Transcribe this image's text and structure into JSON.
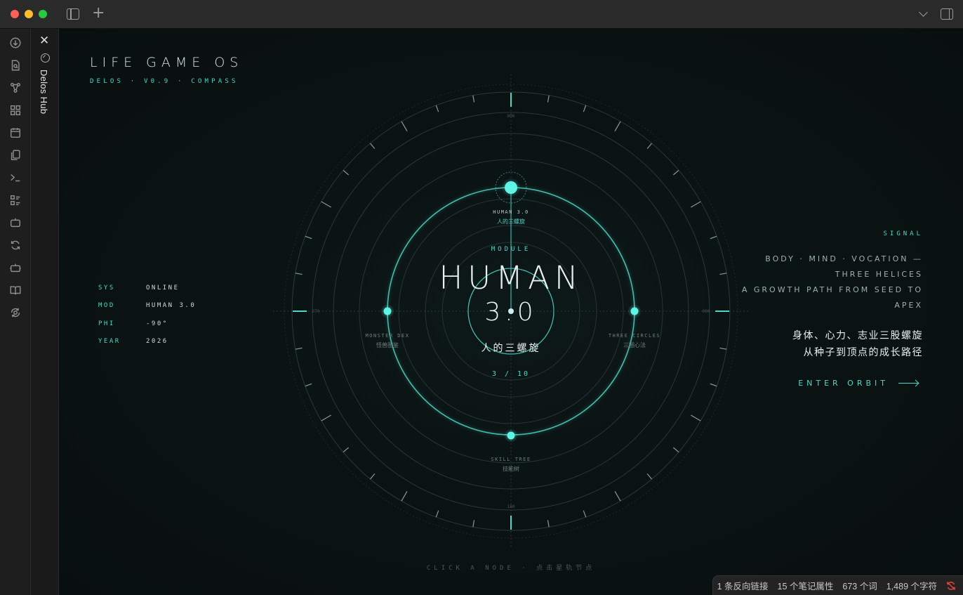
{
  "window": {
    "new_tab_glyph": "+"
  },
  "ribbon": {
    "items": [
      {
        "icon": "download-circle-icon"
      },
      {
        "icon": "file-search-icon"
      },
      {
        "icon": "graph-icon"
      },
      {
        "icon": "dashboard-grid-icon"
      },
      {
        "icon": "calendar-icon"
      },
      {
        "icon": "copy-files-icon"
      },
      {
        "icon": "terminal-icon"
      },
      {
        "icon": "checklist-icon"
      },
      {
        "icon": "bot-icon"
      },
      {
        "icon": "sync-icon"
      },
      {
        "icon": "robot-icon"
      },
      {
        "icon": "book-open-icon"
      },
      {
        "icon": "gear-sync-icon"
      }
    ]
  },
  "side_tab": {
    "label": "Delos Hub"
  },
  "brand": {
    "title": "LIFE GAME OS",
    "subtitle": "DELOS · V0.9 · COMPASS"
  },
  "sys": [
    {
      "key": "SYS",
      "value": "ONLINE"
    },
    {
      "key": "MOD",
      "value": "HUMAN 3.0"
    },
    {
      "key": "PHI",
      "value": "-90°"
    },
    {
      "key": "YEAR",
      "value": "2026"
    }
  ],
  "compass": {
    "module_label": "MODULE",
    "title": "HUMAN",
    "version": "3.0",
    "subtitle_zh": "人的三螺旋",
    "index": "3 / 10",
    "degree_top": "000",
    "degree_right": "090",
    "degree_bottom": "180",
    "degree_left": "270",
    "nodes": {
      "top": {
        "en": "HUMAN 3.0",
        "zh": "人的三螺旋"
      },
      "left": {
        "en": "MONSTER DEX",
        "zh": "怪兽图鉴"
      },
      "right": {
        "en": "THREE CIRCLES",
        "zh": "三圈心法"
      },
      "bottom": {
        "en": "SKILL TREE",
        "zh": "技能树"
      }
    }
  },
  "signal": {
    "label": "SIGNAL",
    "line_en_1": "BODY · MIND · VOCATION — THREE HELICES",
    "line_en_2": "A GROWTH PATH FROM SEED TO APEX",
    "line_zh_1": "身体、心力、志业三股螺旋",
    "line_zh_2": "从种子到顶点的成长路径"
  },
  "cta": {
    "enter_orbit": "ENTER ORBIT"
  },
  "hint": "CLICK A NODE · 点击星轨节点",
  "statusbar": {
    "backlinks": "1 条反向链接",
    "properties": "15 个笔记属性",
    "words": "673 个词",
    "chars": "1,489 个字符"
  },
  "colors": {
    "accent": "#4fd6c9",
    "node": "#5ff5e6",
    "background": "#0a1111"
  }
}
